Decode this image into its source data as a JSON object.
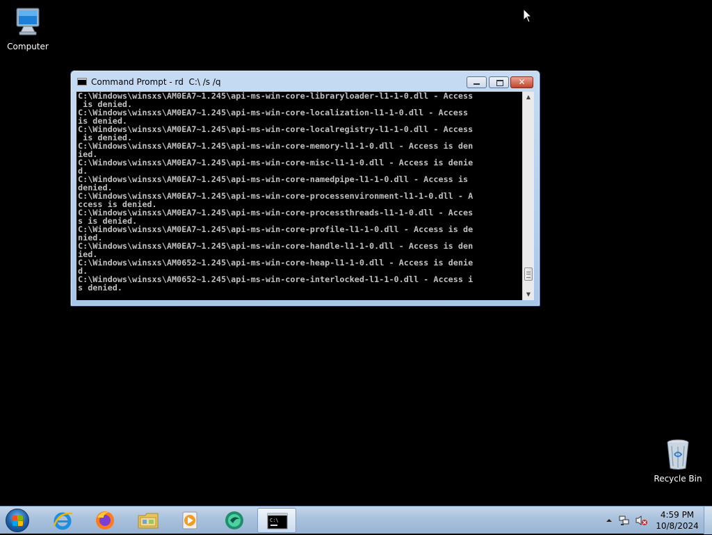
{
  "desktop": {
    "icons": [
      {
        "label": "Computer",
        "icon": "computer-icon"
      },
      {
        "label": "Recycle Bin",
        "icon": "recycle-bin-icon"
      }
    ]
  },
  "window": {
    "title": "Command Prompt - rd  C:\\ /s /q",
    "icon": "command-prompt-icon",
    "buttons": {
      "minimize": "minimize",
      "maximize": "maximize",
      "close": "close"
    },
    "console_lines": [
      "C:\\Windows\\winsxs\\AM0EA7~1.245\\api-ms-win-core-libraryloader-l1-1-0.dll - Access",
      " is denied.",
      "C:\\Windows\\winsxs\\AM0EA7~1.245\\api-ms-win-core-localization-l1-1-0.dll - Access",
      "is denied.",
      "C:\\Windows\\winsxs\\AM0EA7~1.245\\api-ms-win-core-localregistry-l1-1-0.dll - Access",
      " is denied.",
      "C:\\Windows\\winsxs\\AM0EA7~1.245\\api-ms-win-core-memory-l1-1-0.dll - Access is den",
      "ied.",
      "C:\\Windows\\winsxs\\AM0EA7~1.245\\api-ms-win-core-misc-l1-1-0.dll - Access is denie",
      "d.",
      "C:\\Windows\\winsxs\\AM0EA7~1.245\\api-ms-win-core-namedpipe-l1-1-0.dll - Access is",
      "denied.",
      "C:\\Windows\\winsxs\\AM0EA7~1.245\\api-ms-win-core-processenvironment-l1-1-0.dll - A",
      "ccess is denied.",
      "C:\\Windows\\winsxs\\AM0EA7~1.245\\api-ms-win-core-processthreads-l1-1-0.dll - Acces",
      "s is denied.",
      "C:\\Windows\\winsxs\\AM0EA7~1.245\\api-ms-win-core-profile-l1-1-0.dll - Access is de",
      "nied.",
      "C:\\Windows\\winsxs\\AM0EA7~1.245\\api-ms-win-core-handle-l1-1-0.dll - Access is den",
      "ied.",
      "C:\\Windows\\winsxs\\AM0652~1.245\\api-ms-win-core-heap-l1-1-0.dll - Access is denie",
      "d.",
      "C:\\Windows\\winsxs\\AM0652~1.245\\api-ms-win-core-interlocked-l1-1-0.dll - Access i",
      "s denied."
    ],
    "scrollbar": {
      "position": 0.95
    }
  },
  "taskbar": {
    "start": "start-button",
    "pinned": [
      {
        "name": "internet-explorer",
        "active": false
      },
      {
        "name": "firefox",
        "active": false
      },
      {
        "name": "windows-explorer",
        "active": false
      },
      {
        "name": "media-player",
        "active": false
      },
      {
        "name": "browser-app",
        "active": false
      },
      {
        "name": "command-prompt",
        "active": true
      }
    ],
    "tray": {
      "icons": [
        "show-hidden-icons",
        "network-icon",
        "volume-muted-icon"
      ],
      "time": "4:59 PM",
      "date": "10/8/2024"
    }
  },
  "colors": {
    "console_bg": "#000000",
    "console_fg": "#c0c0c0",
    "desktop_bg": "#000000",
    "taskbar": "#a9c1dc"
  }
}
